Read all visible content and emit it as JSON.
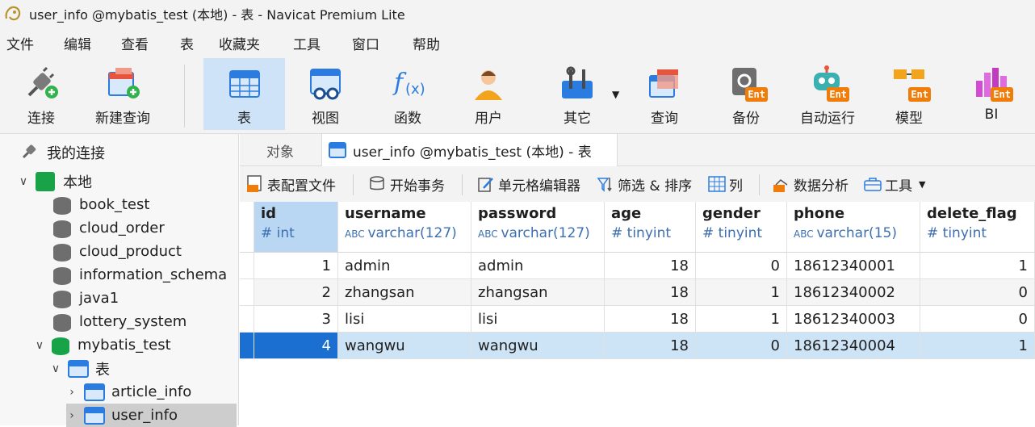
{
  "window": {
    "title": "user_info @mybatis_test (本地) - 表 - Navicat Premium Lite"
  },
  "menu": [
    "文件",
    "编辑",
    "查看",
    "表",
    "收藏夹",
    "工具",
    "窗口",
    "帮助"
  ],
  "toolbar": {
    "items": [
      {
        "label": "连接",
        "icon": "plug-icon"
      },
      {
        "label": "新建查询",
        "icon": "new-query-icon"
      },
      {
        "label": "表",
        "icon": "table-icon",
        "active": true
      },
      {
        "label": "视图",
        "icon": "view-icon"
      },
      {
        "label": "函数",
        "icon": "function-icon"
      },
      {
        "label": "用户",
        "icon": "user-icon"
      },
      {
        "label": "其它",
        "icon": "tools-icon"
      },
      {
        "label": "查询",
        "icon": "query-icon"
      },
      {
        "label": "备份",
        "icon": "backup-icon",
        "badge": "Ent"
      },
      {
        "label": "自动运行",
        "icon": "robot-icon",
        "badge": "Ent"
      },
      {
        "label": "模型",
        "icon": "model-icon",
        "badge": "Ent"
      },
      {
        "label": "BI",
        "icon": "bi-icon",
        "badge": "Ent"
      }
    ]
  },
  "sidebar": {
    "root": "我的连接",
    "connection": "本地",
    "databases": [
      "book_test",
      "cloud_order",
      "cloud_product",
      "information_schema",
      "java1",
      "lottery_system",
      "mybatis_test"
    ],
    "tables_node": "表",
    "tables": [
      "article_info",
      "user_info"
    ]
  },
  "tabs": {
    "objects": "对象",
    "active": "user_info @mybatis_test (本地) - 表"
  },
  "subtoolbar": [
    "表配置文件",
    "开始事务",
    "单元格编辑器",
    "筛选 & 排序",
    "列",
    "数据分析",
    "工具"
  ],
  "table": {
    "columns": [
      {
        "name": "id",
        "type": "int"
      },
      {
        "name": "username",
        "type": "varchar(127)"
      },
      {
        "name": "password",
        "type": "varchar(127)"
      },
      {
        "name": "age",
        "type": "tinyint"
      },
      {
        "name": "gender",
        "type": "tinyint"
      },
      {
        "name": "phone",
        "type": "varchar(15)"
      },
      {
        "name": "delete_flag",
        "type": "tinyint"
      }
    ],
    "rows": [
      [
        "1",
        "admin",
        "admin",
        "18",
        "0",
        "18612340001",
        "1"
      ],
      [
        "2",
        "zhangsan",
        "zhangsan",
        "18",
        "1",
        "18612340002",
        "0"
      ],
      [
        "3",
        "lisi",
        "lisi",
        "18",
        "1",
        "18612340003",
        "0"
      ],
      [
        "4",
        "wangwu",
        "wangwu",
        "18",
        "0",
        "18612340004",
        "1"
      ]
    ]
  },
  "colors": {
    "accent": "#1a6fd0",
    "selection": "#cde4f7",
    "ent_badge": "#f07d0a",
    "db_green": "#19a349"
  }
}
